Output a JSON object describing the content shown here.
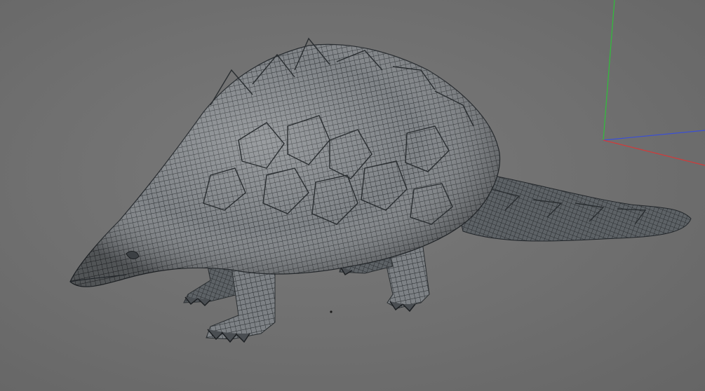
{
  "viewport": {
    "background_color": "#6f6f6f",
    "object": "pangolin-wireframe-mesh",
    "mesh_fill_color": "#7c8084",
    "mesh_wire_color": "#1f2326",
    "shadow_color": "#3a3d40"
  },
  "axis_gizmo": {
    "x_axis_color": "#d23a3a",
    "y_axis_color": "#2fbf3a",
    "z_axis_color": "#3a4fd6"
  }
}
